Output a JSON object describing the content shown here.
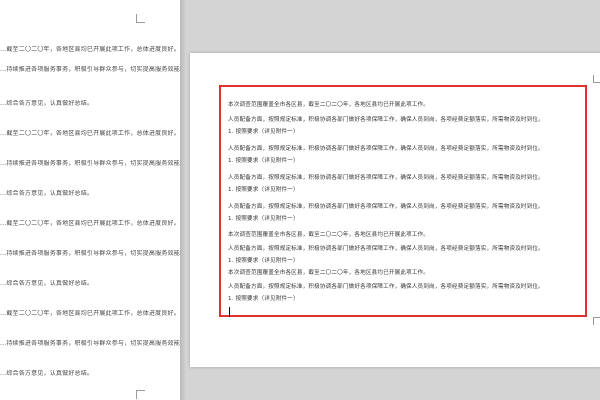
{
  "left_page": {
    "lines": [
      "...截至二〇二〇年，各地区县均已开展此项工作，总体进度良好。",
      "...持续推进各项服务事务，积极引导群众参与，切实提高服务效能。",
      "...综合各方意见，认真做好总结。",
      "...截至二〇二〇年，各地区县均已开展此项工作，总体进度良好。",
      "...持续推进各项服务事务，积极引导群众参与，切实提高服务效能。",
      "...综合各方意见，认真做好总结。"
    ]
  },
  "document": {
    "paragraphs": [
      {
        "line1": "本次调查范围覆盖全市各区县，截至二〇二〇年，各地区县均已开展此项工作。",
        "line2": ""
      },
      {
        "line1": "人员配备方面，按照规定标准，积极协调各部门做好各项保障工作，确保人员到岗，各项经费足额落实，所需物资及时到位。",
        "line2": "1. 按照要求（详见附件一）"
      },
      {
        "line1": "人员配备方面，按照规定标准，积极协调各部门做好各项保障工作，确保人员到岗，各项经费足额落实，所需物资及时到位。",
        "line2": "1. 按照要求（详见附件一）"
      },
      {
        "line1": "人员配备方面，按照规定标准，积极协调各部门做好各项保障工作，确保人员到岗，各项经费足额落实，所需物资及时到位。",
        "line2": "1. 按照要求（详见附件一）"
      },
      {
        "line1": "本次调查范围覆盖全市各区县，截至二〇二〇年，各地区县均已开展此项工作。",
        "line2": ""
      },
      {
        "line1": "人员配备方面，按照规定标准，积极协调各部门做好各项保障工作，确保人员到岗，各项经费足额落实，所需物资及时到位。",
        "line2": "1. 按照要求（详见附件一）"
      }
    ]
  },
  "colors": {
    "selection_border": "#e03030",
    "workspace_bg": "#d4d4d4",
    "highlight_text": "#2f7a2f"
  }
}
